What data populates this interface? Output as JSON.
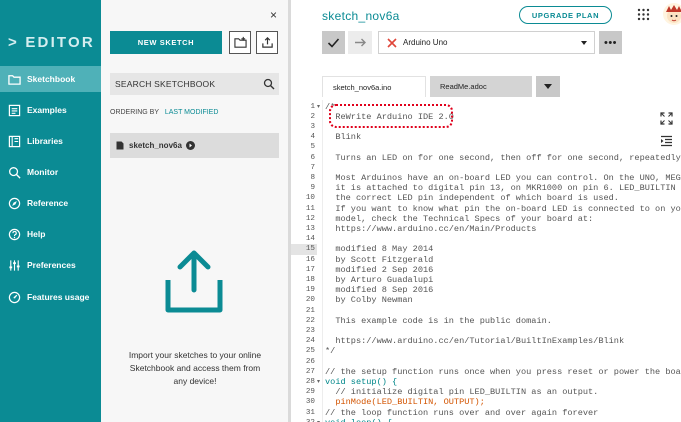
{
  "app": {
    "logo": "EDITOR",
    "sketch_title": "sketch_nov6a",
    "upgrade_label": "UPGRADE PLAN"
  },
  "nav": [
    {
      "label": "Sketchbook",
      "icon": "folder-icon",
      "active": true
    },
    {
      "label": "Examples",
      "icon": "examples-icon",
      "active": false
    },
    {
      "label": "Libraries",
      "icon": "libraries-icon",
      "active": false
    },
    {
      "label": "Monitor",
      "icon": "monitor-icon",
      "active": false
    },
    {
      "label": "Reference",
      "icon": "compass-icon",
      "active": false
    },
    {
      "label": "Help",
      "icon": "help-icon",
      "active": false
    },
    {
      "label": "Preferences",
      "icon": "sliders-icon",
      "active": false
    },
    {
      "label": "Features usage",
      "icon": "gauge-icon",
      "active": false
    }
  ],
  "sketchbook": {
    "close_label": "×",
    "new_sketch_label": "NEW SKETCH",
    "search_placeholder": "SEARCH SKETCHBOOK",
    "ordering_label": "ORDERING BY",
    "ordering_value": "LAST MODIFIED",
    "items": [
      {
        "name": "sketch_nov6a"
      }
    ],
    "import_text": "Import your sketches to your online Sketchbook and access them from any device!"
  },
  "toolbar": {
    "board": "Arduino Uno",
    "more_label": "•••"
  },
  "tabs": [
    {
      "label": "sketch_nov6a.ino",
      "active": true
    },
    {
      "label": "ReadMe.adoc",
      "active": false
    }
  ],
  "code": {
    "current_line": 15,
    "lines": [
      {
        "n": "1",
        "fold": "▾",
        "text": "/*",
        "cls": "c-comment"
      },
      {
        "n": "2",
        "text": "  ReWrite Arduino IDE 2.0",
        "cls": "c-comment"
      },
      {
        "n": "3",
        "text": "",
        "cls": "c-comment"
      },
      {
        "n": "4",
        "text": "  Blink",
        "cls": "c-comment"
      },
      {
        "n": "5",
        "text": "",
        "cls": "c-comment"
      },
      {
        "n": "6",
        "text": "  Turns an LED on for one second, then off for one second, repeatedly.",
        "cls": "c-comment"
      },
      {
        "n": "7",
        "text": "",
        "cls": "c-comment"
      },
      {
        "n": "8",
        "text": "  Most Arduinos have an on-board LED you can control. On the UNO, MEGA and",
        "cls": "c-comment"
      },
      {
        "n": "9",
        "text": "  it is attached to digital pin 13, on MKR1000 on pin 6. LED_BUILTIN is se",
        "cls": "c-comment"
      },
      {
        "n": "10",
        "text": "  the correct LED pin independent of which board is used.",
        "cls": "c-comment"
      },
      {
        "n": "11",
        "text": "  If you want to know what pin the on-board LED is connected to on your Ar",
        "cls": "c-comment"
      },
      {
        "n": "12",
        "text": "  model, check the Technical Specs of your board at:",
        "cls": "c-comment"
      },
      {
        "n": "13",
        "text": "  https://www.arduino.cc/en/Main/Products",
        "cls": "c-comment"
      },
      {
        "n": "14",
        "text": "",
        "cls": "c-comment"
      },
      {
        "n": "15",
        "text": "  modified 8 May 2014",
        "cls": "c-comment"
      },
      {
        "n": "16",
        "text": "  by Scott Fitzgerald",
        "cls": "c-comment"
      },
      {
        "n": "17",
        "text": "  modified 2 Sep 2016",
        "cls": "c-comment"
      },
      {
        "n": "18",
        "text": "  by Arturo Guadalupi",
        "cls": "c-comment"
      },
      {
        "n": "19",
        "text": "  modified 8 Sep 2016",
        "cls": "c-comment"
      },
      {
        "n": "20",
        "text": "  by Colby Newman",
        "cls": "c-comment"
      },
      {
        "n": "21",
        "text": "",
        "cls": "c-comment"
      },
      {
        "n": "22",
        "text": "  This example code is in the public domain.",
        "cls": "c-comment"
      },
      {
        "n": "23",
        "text": "",
        "cls": "c-comment"
      },
      {
        "n": "24",
        "text": "  https://www.arduino.cc/en/Tutorial/BuiltInExamples/Blink",
        "cls": "c-comment"
      },
      {
        "n": "25",
        "text": "*/",
        "cls": "c-comment"
      },
      {
        "n": "26",
        "text": "",
        "cls": "c-comment"
      },
      {
        "n": "27",
        "text": "// the setup function runs once when you press reset or power the board",
        "cls": "c-comment"
      },
      {
        "n": "28",
        "fold": "▾",
        "text": "void setup() {",
        "cls": "c-kw"
      },
      {
        "n": "29",
        "text": "  // initialize digital pin LED_BUILTIN as an output.",
        "cls": "c-comment"
      },
      {
        "n": "30",
        "text": "  pinMode(LED_BUILTIN, OUTPUT);",
        "cls": "c-fn"
      },
      {
        "n": "31",
        "text": "// the loop function runs over and over again forever",
        "cls": "c-comment"
      },
      {
        "n": "32",
        "fold": "▾",
        "text": "void loop() {",
        "cls": "c-kw"
      }
    ]
  },
  "colors": {
    "teal": "#0b8b94",
    "active_nav": "#4fb1b8",
    "highlight_red": "#e0001b"
  }
}
